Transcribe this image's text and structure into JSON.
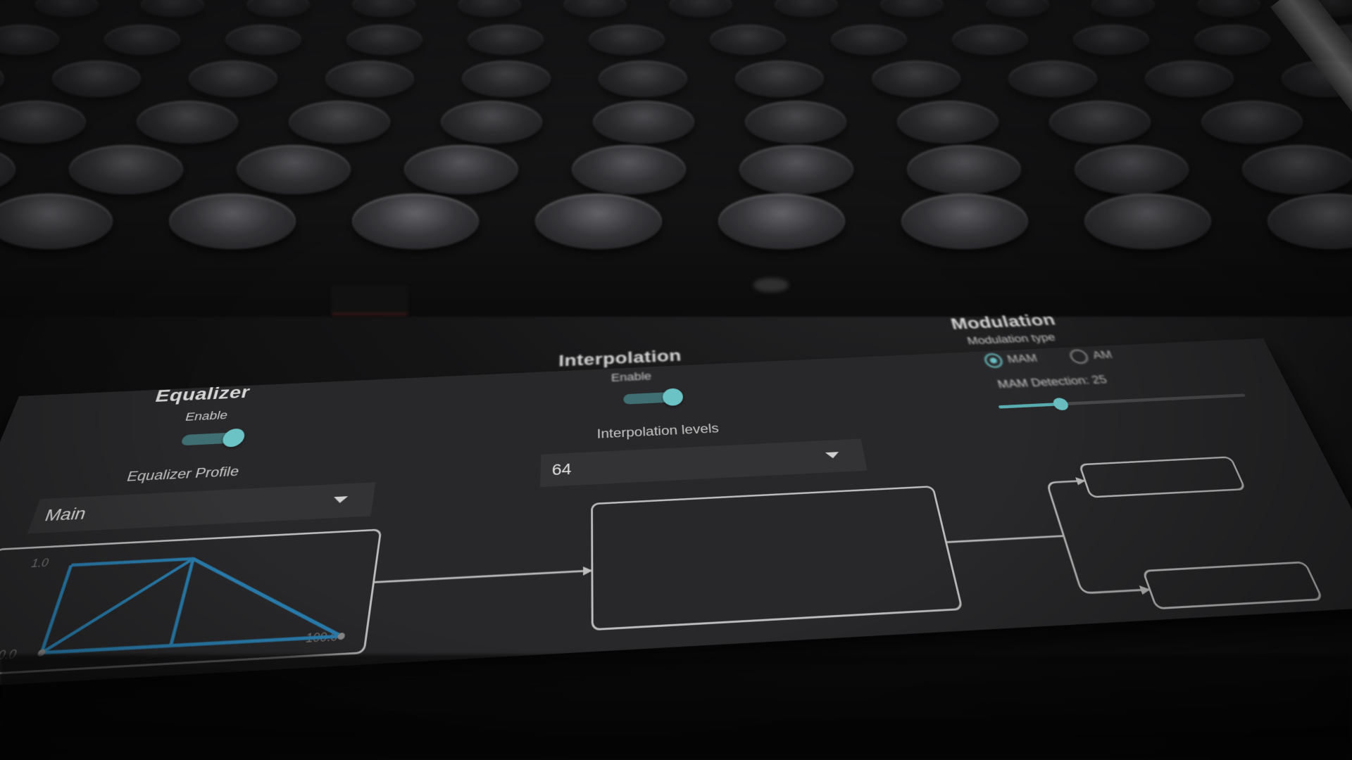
{
  "equalizer": {
    "title": "Equalizer",
    "enable_label": "Enable",
    "enabled": true,
    "profile_label": "Equalizer Profile",
    "profile_value": "Main",
    "graph_tick_top": "1.0",
    "graph_tick_bottom": "0.0",
    "graph_tick_right": "100.0"
  },
  "interpolation": {
    "title": "Interpolation",
    "enable_label": "Enable",
    "enabled": true,
    "levels_label": "Interpolation levels",
    "levels_value": "64"
  },
  "modulation": {
    "title": "Modulation",
    "type_label": "Modulation type",
    "options": [
      "MAM",
      "AM"
    ],
    "selected": "MAM",
    "detection_label": "MAM Detection: 25",
    "detection_level": 0.25
  },
  "colors": {
    "accent": "#6cc3c6",
    "panel": "#28282a",
    "graph_line": "#2a7fb0",
    "outline": "#bdbdbd"
  }
}
